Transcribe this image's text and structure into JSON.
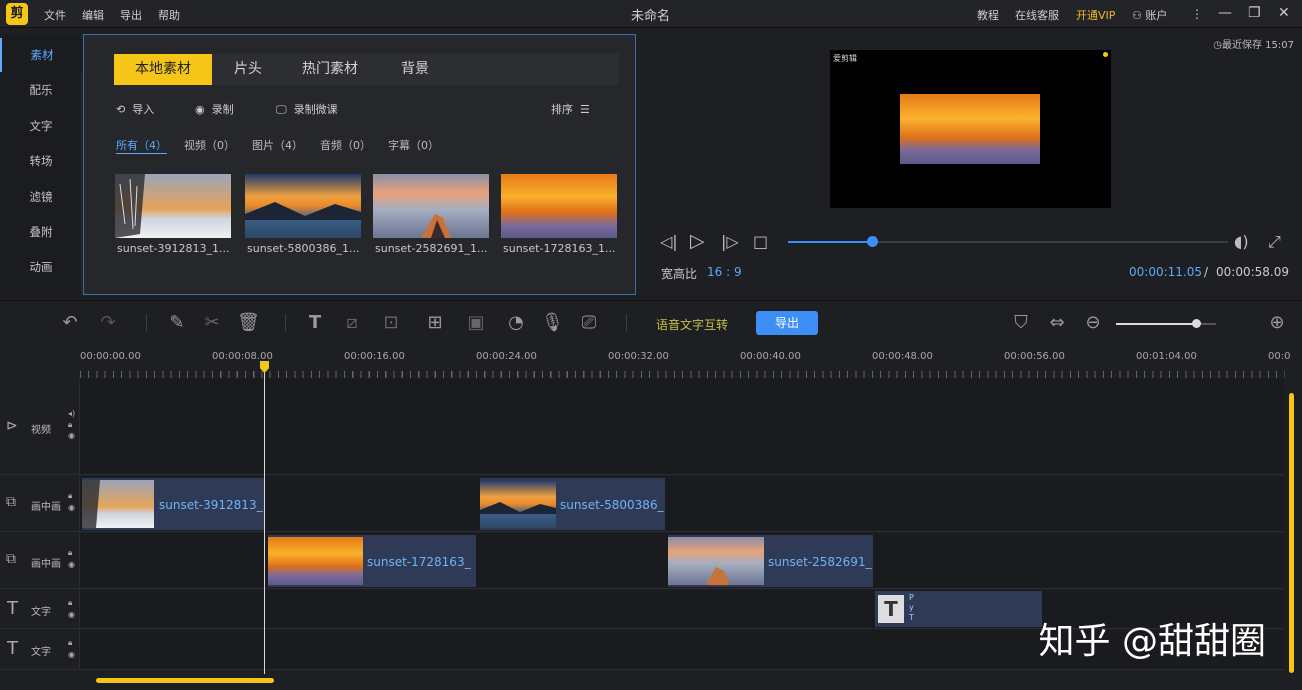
{
  "app": {
    "logo": "剪",
    "title": "未命名"
  },
  "menu": [
    "文件",
    "编辑",
    "导出",
    "帮助"
  ],
  "titlebar_right": {
    "tutorial": "教程",
    "support": "在线客服",
    "vip": "开通VIP",
    "account": "账户"
  },
  "sidebar": {
    "items": [
      {
        "label": "素材",
        "active": true
      },
      {
        "label": "配乐"
      },
      {
        "label": "文字"
      },
      {
        "label": "转场"
      },
      {
        "label": "滤镜"
      },
      {
        "label": "叠附"
      },
      {
        "label": "动画"
      }
    ]
  },
  "media": {
    "tabs": [
      "本地素材",
      "片头",
      "热门素材",
      "背景"
    ],
    "tools": {
      "import": "导入",
      "record": "录制",
      "record_lesson": "录制微课",
      "sort": "排序"
    },
    "filters": [
      "所有（4）",
      "视频（0）",
      "图片（4）",
      "音频（0）",
      "字幕（0）"
    ],
    "thumbs": [
      {
        "name": "sunset-3912813_1...",
        "style": "snow"
      },
      {
        "name": "sunset-5800386_1...",
        "style": "lake"
      },
      {
        "name": "sunset-2582691_1...",
        "style": "peak"
      },
      {
        "name": "sunset-1728163_1...",
        "style": "sea"
      }
    ]
  },
  "preview": {
    "last_saved": "最近保存 15:07",
    "screen_logo": "爱剪辑",
    "aspect_label": "宽高比",
    "aspect_value": "16 : 9",
    "current_time": "00:00:11.05",
    "separator": "/",
    "total_time": "00:00:58.09",
    "progress": 0.19
  },
  "toolbar": {
    "speech_text": "语音文字互转",
    "export": "导出",
    "zoom": 0.8
  },
  "ruler": [
    "00:00:00.00",
    "00:00:08.00",
    "00:00:16.00",
    "00:00:24.00",
    "00:00:32.00",
    "00:00:40.00",
    "00:00:48.00",
    "00:00:56.00",
    "00:01:04.00",
    "00:0"
  ],
  "tracks": [
    {
      "label": "视频",
      "clips": []
    },
    {
      "label": "画中画",
      "clips": [
        {
          "name": "sunset-3912813_",
          "style": "snow"
        },
        {
          "name": "sunset-5800386_",
          "style": "lake"
        }
      ]
    },
    {
      "label": "画中画",
      "clips": [
        {
          "name": "sunset-1728163_",
          "style": "sea"
        },
        {
          "name": "sunset-2582691_",
          "style": "peak"
        }
      ]
    },
    {
      "label": "文字",
      "clips": [
        {
          "name": "P y T",
          "style": "text"
        }
      ]
    },
    {
      "label": "文字",
      "clips": []
    }
  ],
  "watermark": "知乎 @甜甜圈",
  "colors": {
    "accent": "#f5c518",
    "blue": "#3d8ff5",
    "clip": "#2f3a57",
    "clip_text": "#6fb3f5"
  }
}
